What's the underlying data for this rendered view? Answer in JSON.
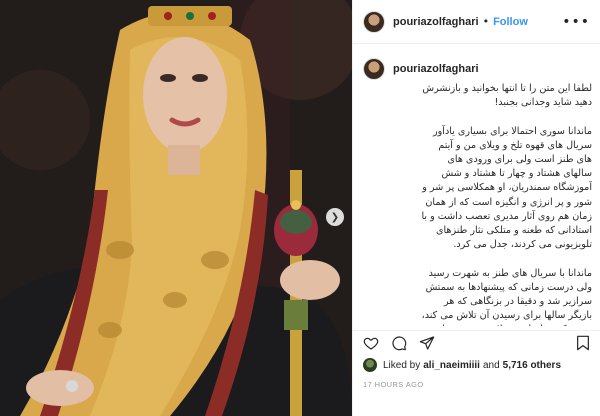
{
  "post": {
    "username": "pouriazolfaghari",
    "follow_label": "Follow",
    "separator": "•",
    "more_label": "•••"
  },
  "caption": {
    "username": "pouriazolfaghari",
    "text": "لطفا این متن را تا انتها بخوانید و بازنشرش\nدهید شاید وجدانی بجنبد!\n\nماندانا سوری احتمالا برای بسیاری یادآور\nسریال های قهوه تلخ و ویلای من و آیتم\nهای طنز است ولی برای ورودی های\nسالهای هشتاد و چهار تا هشتاد و شش\nآموزشگاه سمندریان، او همکلاسی پر شر و\nشور و پر انرژی و انگیزه است که از همان\nزمان هم روی آثار مدیری تعصب داشت و با\nاستادانی که طعنه و متلکی نثار طنزهای\nتلویزیونی می کردند، جدل می کرد.\n\nماندانا با سریال های طنز به شهرت رسید\nولی درست زمانی که پیشنهادها به سمتش\nسرازیر شد و دقیقا در بزنگاهی که هر\nبازیگر سالها برای رسیدن آن تلاش می کند،\nفهمید که به ام اس مبتلا شده. در فضای\nبجنجه ای سینمای ایران، این خبر خیلی زود"
  },
  "likes": {
    "prefix": "Liked by",
    "user": "ali_naeimiiii",
    "middle": "and",
    "others": "5,716 others"
  },
  "timestamp": "17 HOURS AGO",
  "icons": [
    "heart-icon",
    "comment-icon",
    "share-icon",
    "bookmark-icon",
    "chevron-right-icon"
  ],
  "colors": {
    "link": "#3897f0",
    "text": "#262626",
    "muted": "#999999",
    "border": "#efefef"
  }
}
